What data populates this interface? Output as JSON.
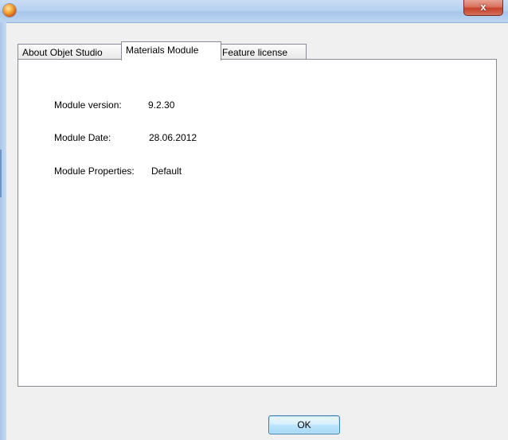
{
  "window": {
    "title": "",
    "close_glyph": "x",
    "icon": "app-orb-icon"
  },
  "tabs": [
    {
      "label": "About Objet Studio",
      "active": false
    },
    {
      "label": "Materials Module",
      "active": true
    },
    {
      "label": "Feature license",
      "active": false
    }
  ],
  "module": {
    "version_label": "Module version:",
    "version_value": "9.2.30",
    "date_label": "Module Date:",
    "date_value": "28.06.2012",
    "properties_label": "Module Properties:",
    "properties_value": "Default"
  },
  "buttons": {
    "ok_label": "OK"
  },
  "colors": {
    "titlebar": "#b7d1ef",
    "close_button": "#c6412a",
    "ok_button_border": "#3c7fb1"
  }
}
